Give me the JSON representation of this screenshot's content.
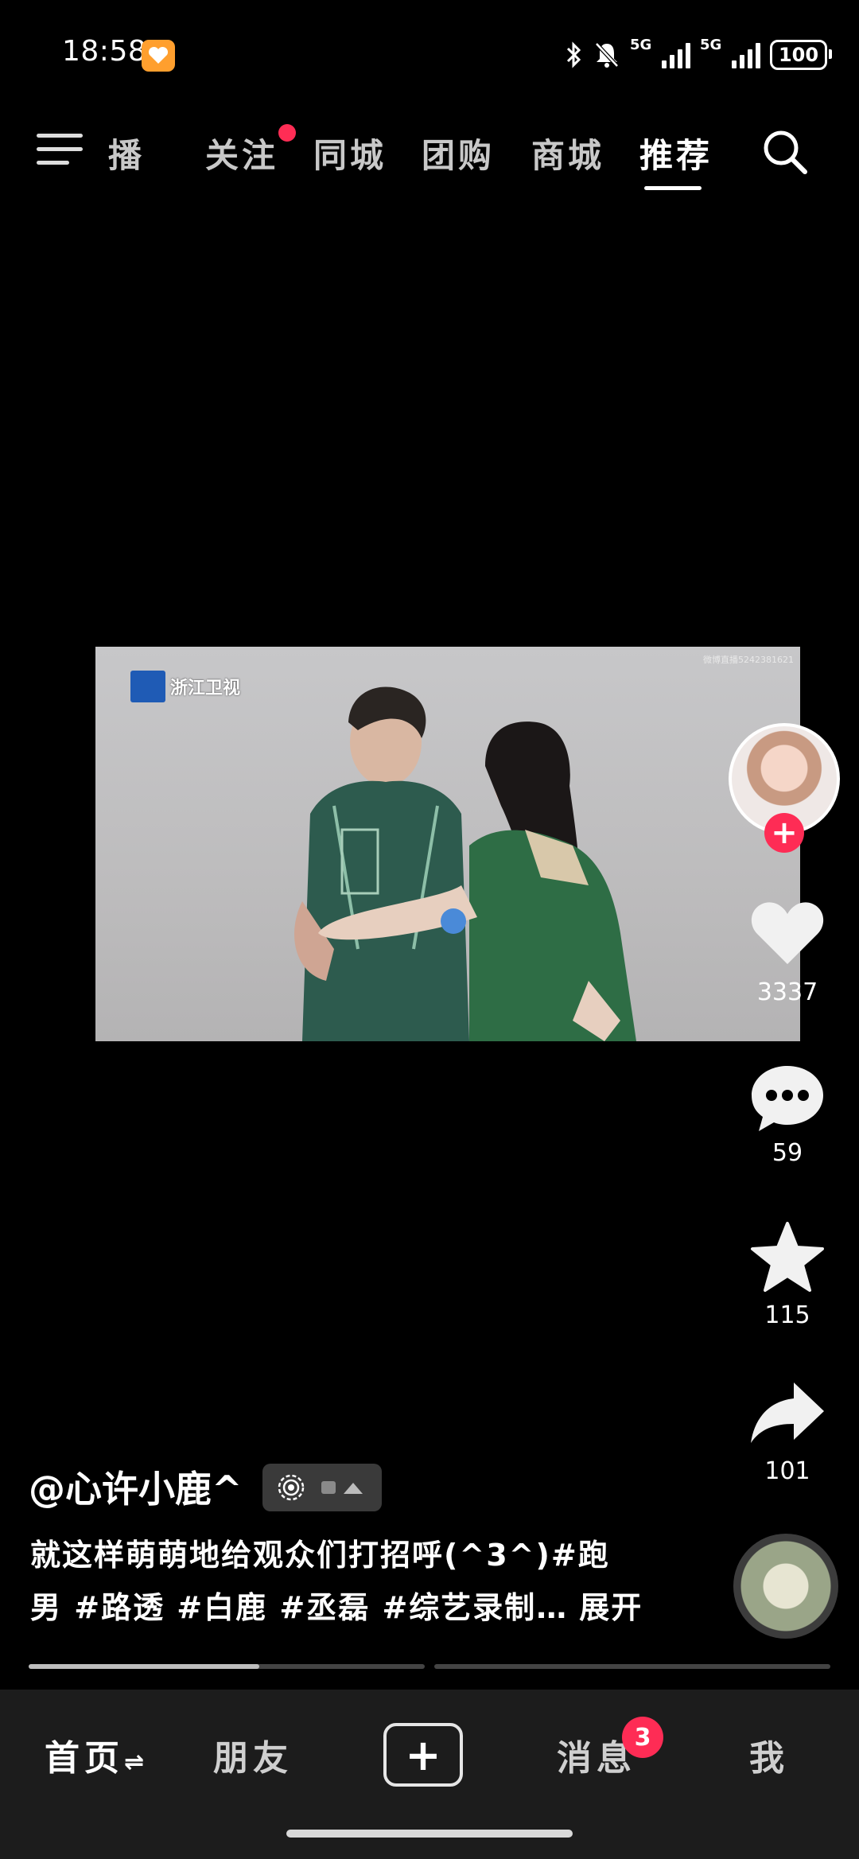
{
  "status_bar": {
    "time": "18:58",
    "network_1": "5G",
    "network_2": "5G",
    "battery": "100",
    "icons": [
      "bluetooth-icon",
      "mute-icon",
      "signal-icon",
      "battery-icon"
    ]
  },
  "top_tabs": {
    "items": [
      {
        "label": "播",
        "active": false
      },
      {
        "label": "关注",
        "active": false,
        "has_dot": true
      },
      {
        "label": "同城",
        "active": false
      },
      {
        "label": "团购",
        "active": false
      },
      {
        "label": "商城",
        "active": false
      },
      {
        "label": "推荐",
        "active": true
      }
    ]
  },
  "video": {
    "channel": "浙江卫视",
    "watermark": "微博直播5242381621"
  },
  "actions": {
    "likes": "3337",
    "comments": "59",
    "favorites": "115",
    "shares": "101",
    "follow": "+"
  },
  "post": {
    "username": "@心许小鹿^",
    "caption_line1": "就这样萌萌地给观众们打招呼(^3^)#跑",
    "caption_line2": "男 #路透 #白鹿 #丞磊 #综艺录制…",
    "expand": "展开"
  },
  "bottom_nav": {
    "items": [
      "首页",
      "朋友",
      "+",
      "消息",
      "我"
    ],
    "home_refresh": "⇌",
    "messages_badge": "3"
  },
  "colors": {
    "accent": "#fe2c55",
    "background": "#000000",
    "nav_bg": "#1c1c1c"
  }
}
